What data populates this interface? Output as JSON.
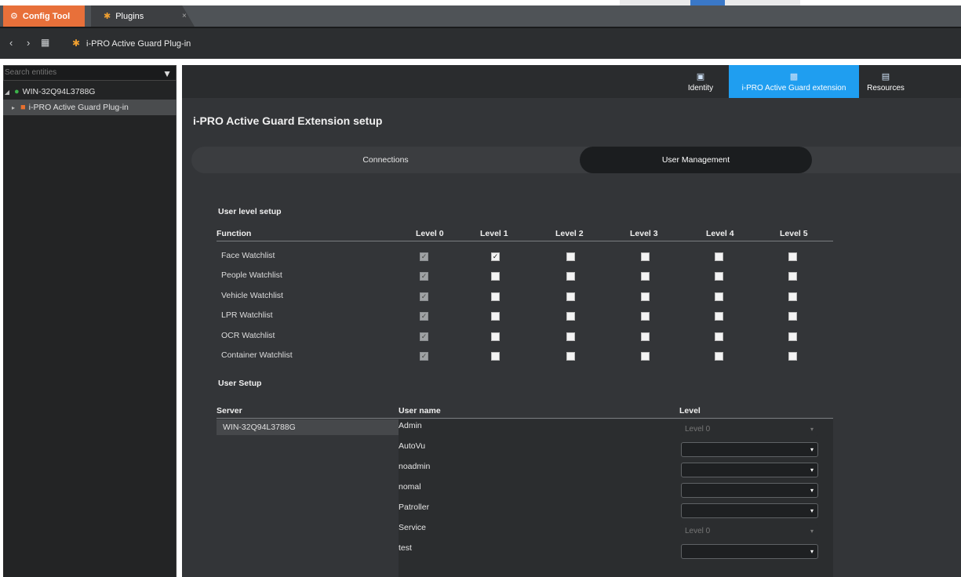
{
  "window": {
    "tabs": [
      {
        "label": "Config Tool",
        "icon": "config-tool-icon"
      },
      {
        "label": "Plugins",
        "icon": "plugins-icon"
      }
    ],
    "close_glyph": "×"
  },
  "nav": {
    "back_glyph": "‹",
    "forward_glyph": "›",
    "breadcrumb": "i-PRO Active Guard Plug-in"
  },
  "left_panel": {
    "search_placeholder": "Search entities",
    "tree": [
      {
        "label": "WIN-32Q94L3788G",
        "icon": "server-icon",
        "expanded": true
      },
      {
        "label": "i-PRO Active Guard Plug-in",
        "icon": "plugin-icon",
        "selected": true
      }
    ]
  },
  "right_tabs": [
    {
      "label": "Identity",
      "icon": "identity-icon",
      "active": false
    },
    {
      "label": "i-PRO Active Guard extension",
      "icon": "extension-icon",
      "active": true
    },
    {
      "label": "Resources",
      "icon": "resources-icon",
      "active": false
    }
  ],
  "page": {
    "title": "i-PRO Active Guard Extension setup",
    "segments": {
      "connections": "Connections",
      "user_management": "User Management",
      "active": "User Management"
    }
  },
  "user_level_setup": {
    "title": "User level setup",
    "columns": [
      "Function",
      "Level 0",
      "Level 1",
      "Level 2",
      "Level 3",
      "Level 4",
      "Level 5"
    ],
    "rows": [
      {
        "function": "Face Watchlist",
        "levels": [
          true,
          true,
          false,
          false,
          false,
          false
        ]
      },
      {
        "function": "People Watchlist",
        "levels": [
          true,
          false,
          false,
          false,
          false,
          false
        ]
      },
      {
        "function": "Vehicle Watchlist",
        "levels": [
          true,
          false,
          false,
          false,
          false,
          false
        ]
      },
      {
        "function": "LPR Watchlist",
        "levels": [
          true,
          false,
          false,
          false,
          false,
          false
        ]
      },
      {
        "function": "OCR Watchlist",
        "levels": [
          true,
          false,
          false,
          false,
          false,
          false
        ]
      },
      {
        "function": "Container Watchlist",
        "levels": [
          true,
          false,
          false,
          false,
          false,
          false
        ]
      }
    ]
  },
  "user_setup": {
    "title": "User Setup",
    "columns": [
      "Server",
      "User name",
      "Level"
    ],
    "server": "WIN-32Q94L3788G",
    "users": [
      {
        "name": "Admin",
        "level": "Level 0",
        "editable": false
      },
      {
        "name": "AutoVu",
        "level": "",
        "editable": true
      },
      {
        "name": "noadmin",
        "level": "",
        "editable": true
      },
      {
        "name": "nomal",
        "level": "",
        "editable": true
      },
      {
        "name": "Patroller",
        "level": "",
        "editable": true
      },
      {
        "name": "Service",
        "level": "Level 0",
        "editable": false
      },
      {
        "name": "test",
        "level": "",
        "editable": true
      }
    ]
  }
}
